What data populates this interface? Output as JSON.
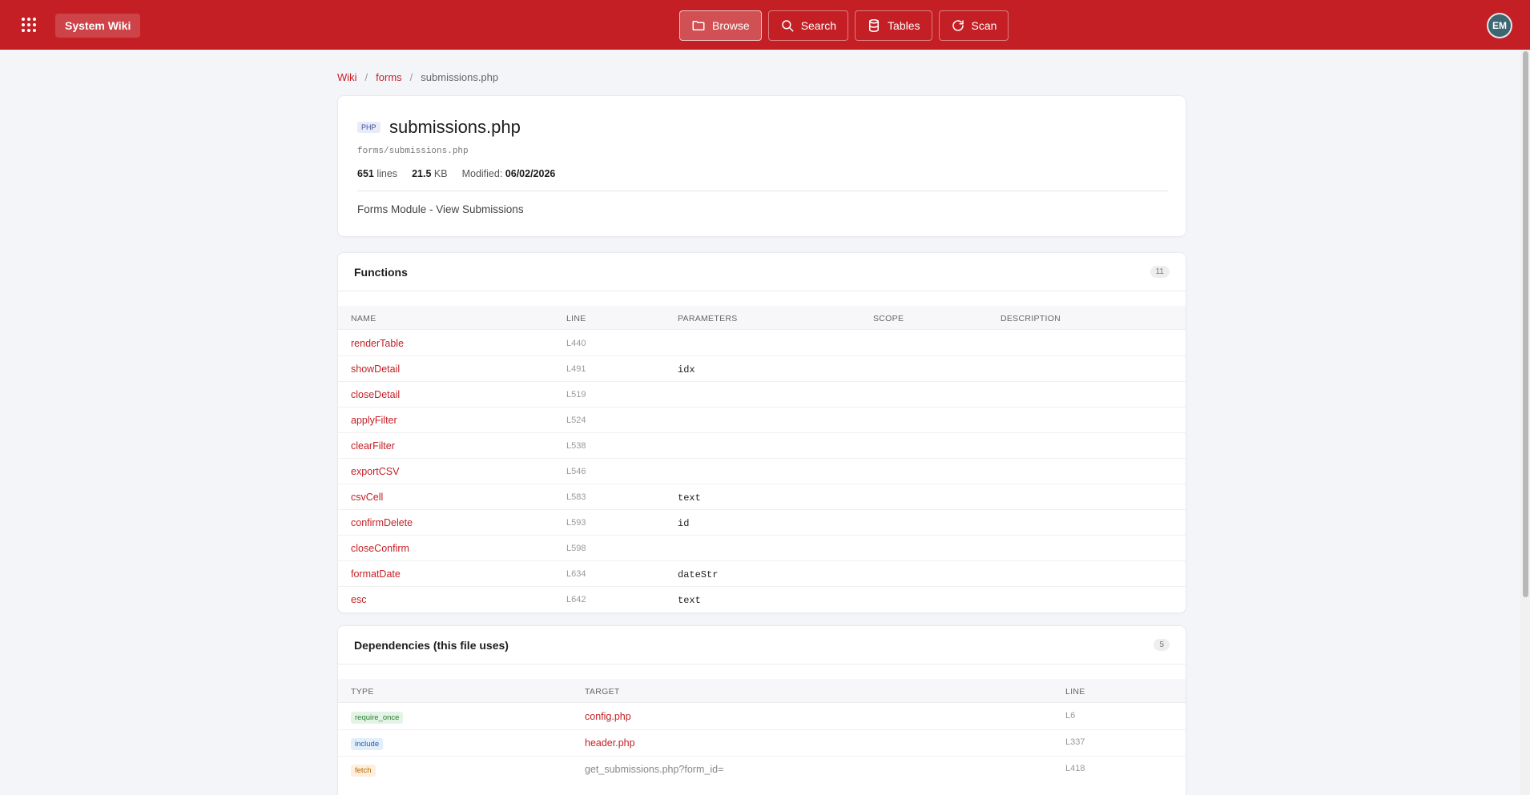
{
  "header": {
    "brand": "System Wiki",
    "nav": [
      {
        "label": "Browse",
        "icon": "folder-icon",
        "active": true
      },
      {
        "label": "Search",
        "icon": "search-icon",
        "active": false
      },
      {
        "label": "Tables",
        "icon": "database-icon",
        "active": false
      },
      {
        "label": "Scan",
        "icon": "refresh-icon",
        "active": false
      }
    ],
    "avatar": "EM",
    "brand_color": "#c41f25"
  },
  "breadcrumb": {
    "root": "Wiki",
    "folder": "forms",
    "current": "submissions.php",
    "separator": "/"
  },
  "file": {
    "lang": "PHP",
    "name": "submissions.php",
    "path": "forms/submissions.php",
    "lines": "651",
    "lines_label": "lines",
    "size": "21.5",
    "size_unit": "KB",
    "modified_label": "Modified:",
    "modified": "06/02/2026",
    "description": "Forms Module - View Submissions"
  },
  "functions": {
    "title": "Functions",
    "count": "11",
    "columns": {
      "name": "Name",
      "line": "Line",
      "params": "Parameters",
      "scope": "Scope",
      "description": "Description"
    },
    "rows": [
      {
        "name": "renderTable",
        "line": "L440",
        "params": ""
      },
      {
        "name": "showDetail",
        "line": "L491",
        "params": "idx"
      },
      {
        "name": "closeDetail",
        "line": "L519",
        "params": ""
      },
      {
        "name": "applyFilter",
        "line": "L524",
        "params": ""
      },
      {
        "name": "clearFilter",
        "line": "L538",
        "params": ""
      },
      {
        "name": "exportCSV",
        "line": "L546",
        "params": ""
      },
      {
        "name": "csvCell",
        "line": "L583",
        "params": "text"
      },
      {
        "name": "confirmDelete",
        "line": "L593",
        "params": "id"
      },
      {
        "name": "closeConfirm",
        "line": "L598",
        "params": ""
      },
      {
        "name": "formatDate",
        "line": "L634",
        "params": "dateStr"
      },
      {
        "name": "esc",
        "line": "L642",
        "params": "text"
      }
    ]
  },
  "dependencies": {
    "title": "Dependencies (this file uses)",
    "count": "5",
    "columns": {
      "type": "Type",
      "target": "Target",
      "line": "Line"
    },
    "rows": [
      {
        "type": "require_once",
        "type_bg": "#e3f4e6",
        "type_color": "#2e7d32",
        "target": "config.php",
        "target_link": true,
        "line": "L6"
      },
      {
        "type": "include",
        "type_bg": "#e3eefb",
        "type_color": "#1e5fa8",
        "target": "header.php",
        "target_link": true,
        "line": "L337"
      },
      {
        "type": "fetch",
        "type_bg": "#fdefdc",
        "type_color": "#b26a00",
        "target": "get_submissions.php?form_id=",
        "target_link": false,
        "line": "L418"
      }
    ]
  }
}
